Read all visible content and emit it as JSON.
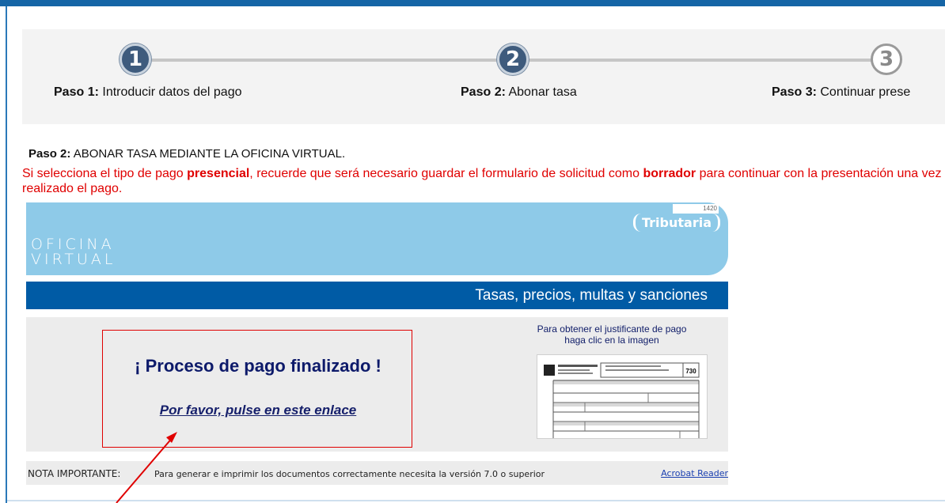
{
  "steps": [
    {
      "number": "1",
      "bold": "Paso 1:",
      "label": " Introducir datos del pago"
    },
    {
      "number": "2",
      "bold": "Paso 2:",
      "label": " Abonar tasa"
    },
    {
      "number": "3",
      "bold": "Paso 3:",
      "label": " Continuar prese"
    }
  ],
  "section": {
    "title_bold": "Paso 2:",
    "title": " ABONAR TASA MEDIANTE LA OFICINA VIRTUAL.",
    "notice_1": "Si selecciona el tipo de pago ",
    "notice_bold_1": "presencial",
    "notice_2": ", recuerde que será necesario guardar el formulario de solicitud como ",
    "notice_bold_2": "borrador",
    "notice_3": " para continuar con la presentación una vez realizado el pago."
  },
  "banner": {
    "line1": "OFICINA",
    "line2": "VIRTUAL",
    "code": "1420",
    "brand": "Tributaria",
    "subtitle": "Tasas, precios, multas y sanciones"
  },
  "payment": {
    "headline": "¡ Proceso de pago finalizado !",
    "link": "Por favor, pulse en este enlace",
    "receipt_hint_1": "Para obtener el justificante de pago",
    "receipt_hint_2": "haga clic en la imagen",
    "form_number": "730"
  },
  "note": {
    "label": "NOTA IMPORTANTE:",
    "text": "Para generar e imprimir los documentos correctamente necesita la versión 7.0 o superior",
    "link": "Acrobat Reader"
  },
  "colors": {
    "accent_blue": "#005ba5",
    "banner_blue": "#8ecae8",
    "alert_red": "#e00000",
    "step_active": "#3e5b7d"
  }
}
